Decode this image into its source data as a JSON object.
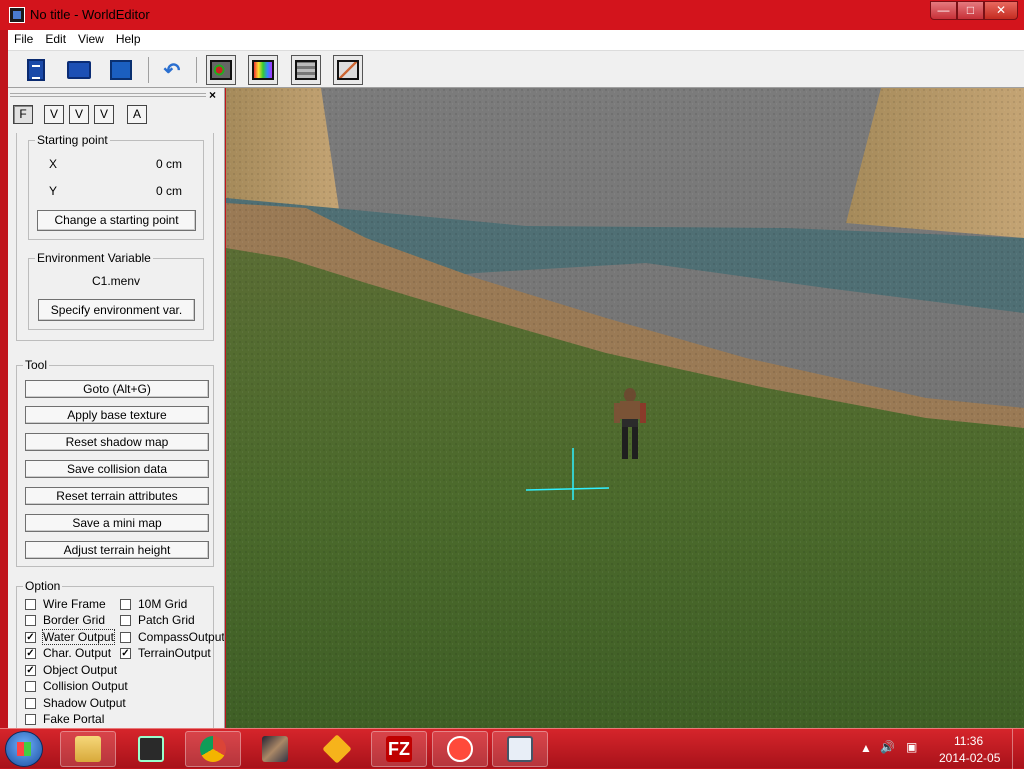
{
  "window": {
    "title": "No title - WorldEditor"
  },
  "menu": [
    "File",
    "Edit",
    "View",
    "Help"
  ],
  "toolbar": {
    "icons": [
      "new-document-icon",
      "open-folder-icon",
      "save-monitor-icon",
      "undo-icon",
      "object-mode-icon",
      "texture-mode-icon",
      "tile-mode-icon",
      "brush-mode-icon"
    ]
  },
  "panel": {
    "close_glyph": "×",
    "tabs": [
      "F",
      "V",
      "V",
      "V",
      "A"
    ],
    "starting_point": {
      "legend": "Starting point",
      "x_label": "X",
      "x_value": "0 cm",
      "y_label": "Y",
      "y_value": "0 cm",
      "button": "Change a starting point"
    },
    "environment": {
      "legend": "Environment Variable",
      "value": "C1.menv",
      "button": "Specify environment var."
    },
    "tool": {
      "legend": "Tool",
      "buttons": [
        "Goto (Alt+G)",
        "Apply base texture",
        "Reset shadow map",
        "Save collision data",
        "Reset terrain attributes",
        "Save a mini map",
        "Adjust terrain height"
      ]
    },
    "option": {
      "legend": "Option",
      "items": [
        {
          "label": "Wire Frame",
          "checked": false
        },
        {
          "label": "10M Grid",
          "checked": false
        },
        {
          "label": "Border Grid",
          "checked": false
        },
        {
          "label": "Patch Grid",
          "checked": false
        },
        {
          "label": "Water Output",
          "checked": true
        },
        {
          "label": "CompassOutput",
          "checked": false
        },
        {
          "label": "Char. Output",
          "checked": true
        },
        {
          "label": "TerrainOutput",
          "checked": true
        },
        {
          "label": "Object Output",
          "checked": true
        },
        {
          "label": "Collision Output",
          "checked": false
        },
        {
          "label": "Shadow Output",
          "checked": false
        },
        {
          "label": "Fake Portal",
          "checked": false
        }
      ]
    }
  },
  "taskbar": {
    "apps": [
      "file-explorer-icon",
      "task-manager-icon",
      "chrome-icon",
      "game-icon",
      "winamp-icon",
      "filezilla-icon",
      "messenger-icon",
      "worldeditor-icon"
    ],
    "time": "11:36",
    "date": "2014-02-05"
  }
}
